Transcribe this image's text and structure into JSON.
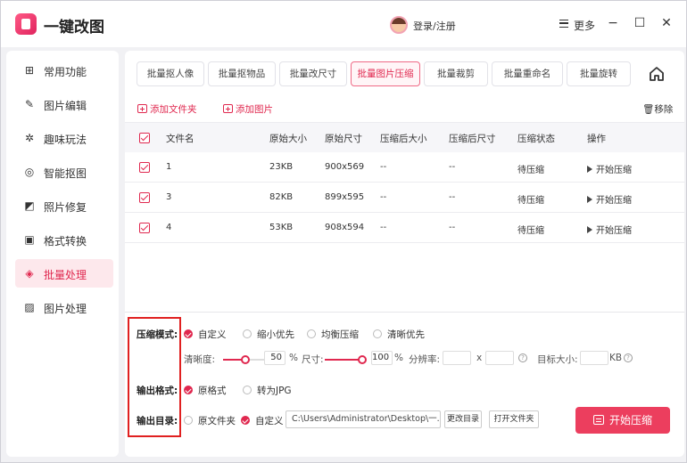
{
  "app": {
    "title": "一键改图",
    "login": "登录/注册",
    "more": "更多",
    "minimize": "−",
    "maximize": "☐",
    "close": "✕"
  },
  "sidebar": {
    "items": [
      {
        "label": "常用功能",
        "icon": "grid-icon",
        "glyph": "⊞"
      },
      {
        "label": "图片编辑",
        "icon": "edit-icon",
        "glyph": "✎"
      },
      {
        "label": "趣味玩法",
        "icon": "sparkle-icon",
        "glyph": "✲"
      },
      {
        "label": "智能抠图",
        "icon": "target-icon",
        "glyph": "◎"
      },
      {
        "label": "照片修复",
        "icon": "photo-fix-icon",
        "glyph": "◩"
      },
      {
        "label": "格式转换",
        "icon": "convert-icon",
        "glyph": "▣"
      },
      {
        "label": "批量处理",
        "icon": "layers-icon",
        "glyph": "◈",
        "active": true
      },
      {
        "label": "图片处理",
        "icon": "image-icon",
        "glyph": "▨"
      }
    ]
  },
  "tabs": [
    {
      "label": "批量抠人像"
    },
    {
      "label": "批量抠物品"
    },
    {
      "label": "批量改尺寸"
    },
    {
      "label": "批量图片压缩",
      "active": true
    },
    {
      "label": "批量裁剪"
    },
    {
      "label": "批量重命名"
    },
    {
      "label": "批量旋转"
    }
  ],
  "actions": {
    "add_folder": "添加文件夹",
    "add_image": "添加图片",
    "remove": "移除"
  },
  "table": {
    "headers": [
      "文件名",
      "原始大小",
      "原始尺寸",
      "压缩后大小",
      "压缩后尺寸",
      "压缩状态",
      "操作"
    ],
    "rows": [
      {
        "name": "1",
        "size": "23KB",
        "dims": "900x569",
        "new_size": "--",
        "new_dims": "--",
        "status": "待压缩",
        "action": "开始压缩"
      },
      {
        "name": "3",
        "size": "82KB",
        "dims": "899x595",
        "new_size": "--",
        "new_dims": "--",
        "status": "待压缩",
        "action": "开始压缩"
      },
      {
        "name": "4",
        "size": "53KB",
        "dims": "908x594",
        "new_size": "--",
        "new_dims": "--",
        "status": "待压缩",
        "action": "开始压缩"
      }
    ]
  },
  "settings": {
    "mode_label": "压缩模式:",
    "modes": [
      "自定义",
      "缩小优先",
      "均衡压缩",
      "清晰优先"
    ],
    "clarity_label": "清晰度:",
    "clarity_value": "50",
    "clarity_unit": "%",
    "clarity_fraction": 0.5,
    "size_label": "尺寸:",
    "size_value": "100",
    "size_unit": "%",
    "size_fraction": 1.0,
    "resolution_label": "分辨率:",
    "resolution_x": "x",
    "target_label": "目标大小:",
    "target_unit": "KB",
    "format_label": "输出格式:",
    "formats": [
      "原格式",
      "转为JPG"
    ],
    "dir_label": "输出目录:",
    "dirs": [
      "原文件夹",
      "自定义"
    ],
    "path": "C:\\Users\\Administrator\\Desktop\\一...",
    "change_dir": "更改目录",
    "open_folder": "打开文件夹",
    "start": "开始压缩"
  },
  "colors": {
    "accent": "#e0284f",
    "button": "#ec3e5e",
    "highlight_box": "#e02020"
  }
}
